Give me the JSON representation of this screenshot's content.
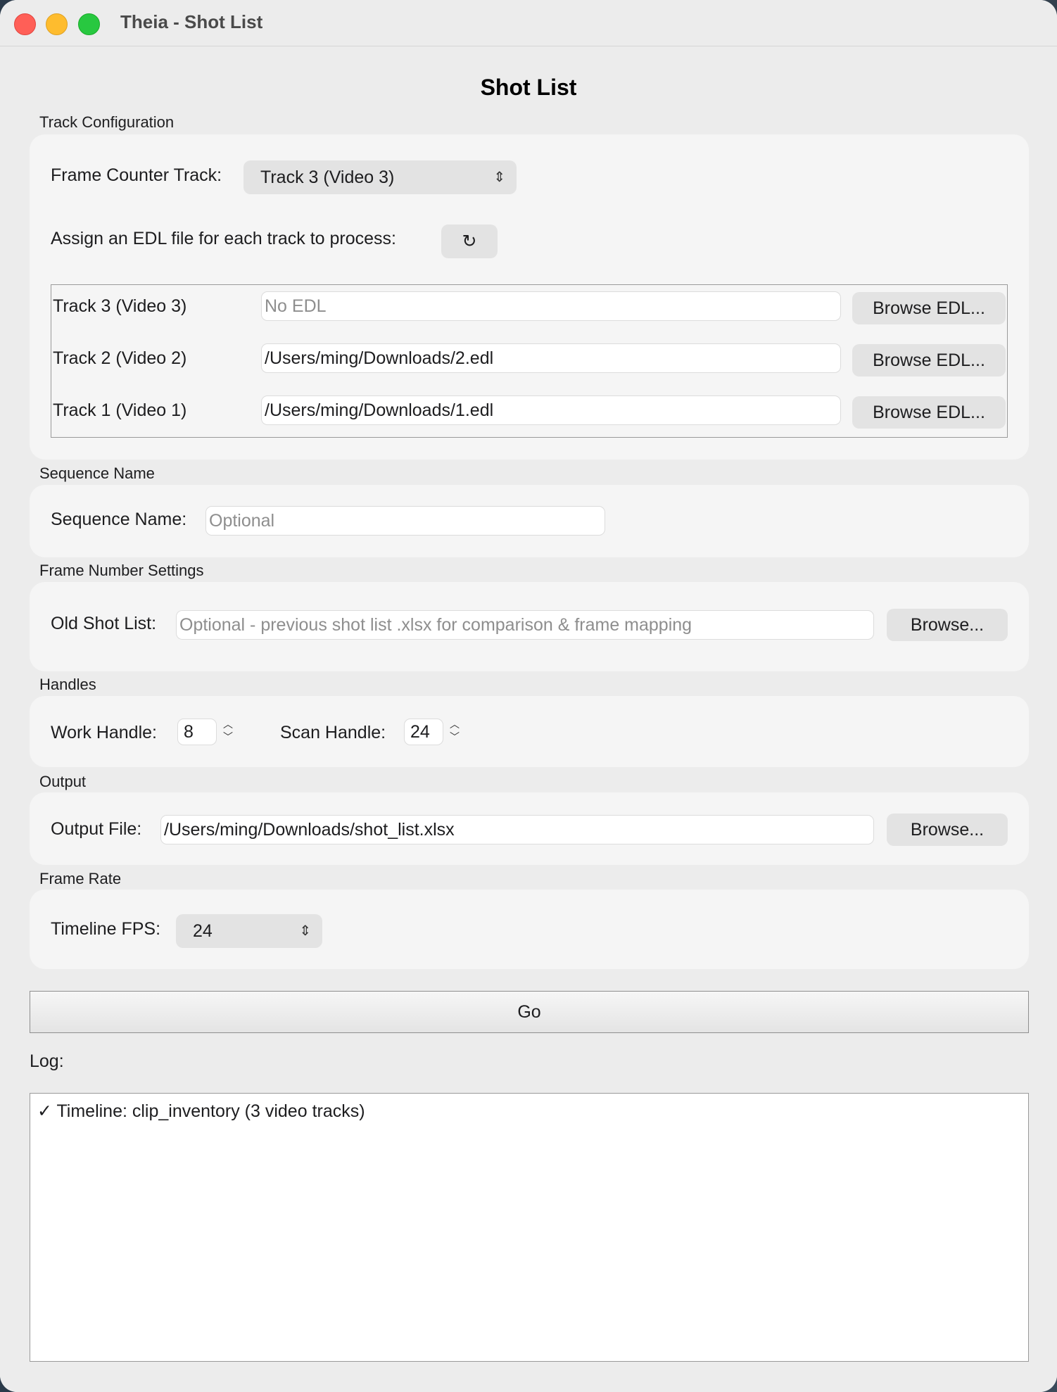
{
  "window": {
    "title": "Theia - Shot List"
  },
  "page": {
    "title": "Shot List"
  },
  "track_config": {
    "section_label": "Track Configuration",
    "frame_counter_label": "Frame Counter Track:",
    "frame_counter_value": "Track 3 (Video 3)",
    "assign_label": "Assign an EDL file for each track to process:",
    "refresh_icon": "↻",
    "tracks": [
      {
        "name": "Track 3  (Video 3)",
        "value": "",
        "placeholder": "No EDL",
        "button": "Browse EDL..."
      },
      {
        "name": "Track 2  (Video 2)",
        "value": "/Users/ming/Downloads/2.edl",
        "placeholder": "",
        "button": "Browse EDL..."
      },
      {
        "name": "Track 1  (Video 1)",
        "value": "/Users/ming/Downloads/1.edl",
        "placeholder": "",
        "button": "Browse EDL..."
      }
    ]
  },
  "sequence": {
    "section_label": "Sequence Name",
    "label": "Sequence Name:",
    "placeholder": "Optional"
  },
  "frame_number": {
    "section_label": "Frame Number Settings",
    "label": "Old Shot List:",
    "placeholder": "Optional - previous shot list .xlsx for comparison & frame mapping",
    "button": "Browse..."
  },
  "handles": {
    "section_label": "Handles",
    "work_label": "Work Handle:",
    "work_value": "8",
    "scan_label": "Scan Handle:",
    "scan_value": "24"
  },
  "output": {
    "section_label": "Output",
    "label": "Output File:",
    "value": "/Users/ming/Downloads/shot_list.xlsx",
    "button": "Browse..."
  },
  "frame_rate": {
    "section_label": "Frame Rate",
    "label": "Timeline FPS:",
    "value": "24"
  },
  "actions": {
    "go_label": "Go"
  },
  "log": {
    "label": "Log:",
    "lines": [
      "✓ Timeline: clip_inventory (3 video tracks)"
    ]
  },
  "colors": {
    "close": "#ff5f57",
    "minimize": "#febc2e",
    "zoom": "#28c840",
    "window_bg": "#ececec",
    "group_bg": "#f5f5f5"
  }
}
